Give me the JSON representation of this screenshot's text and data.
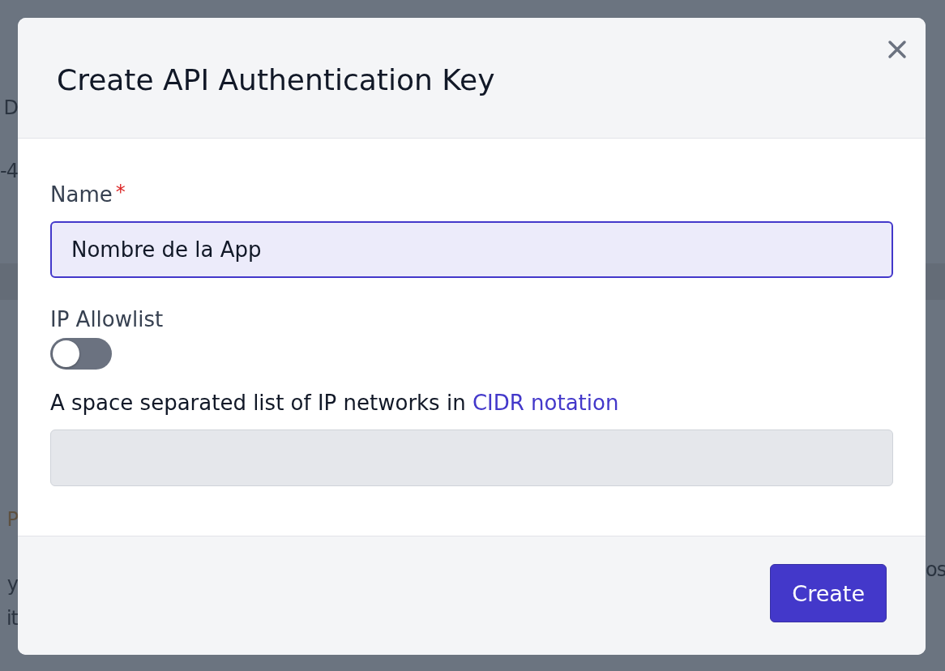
{
  "background": {
    "left_fragments": [
      "D",
      "-4",
      "P",
      "y",
      "it"
    ],
    "right_fragments": [
      "os"
    ]
  },
  "dialog": {
    "title": "Create API Authentication Key",
    "name_field": {
      "label": "Name",
      "required_mark": "*",
      "value": "Nombre de la App"
    },
    "allowlist": {
      "label": "IP Allowlist",
      "on": false
    },
    "networks": {
      "description": "A space separated list of IP networks in ",
      "link": "CIDR notation",
      "disabled": true
    },
    "primary_button": "Create"
  }
}
